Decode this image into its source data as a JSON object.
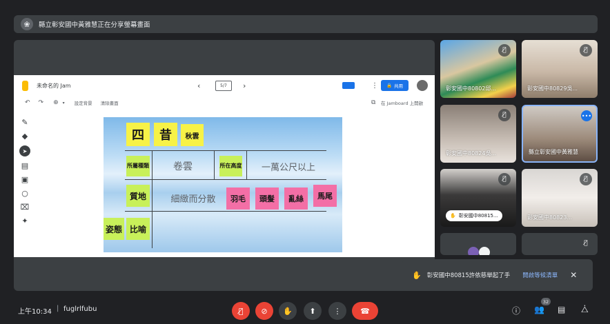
{
  "presenting_bar": {
    "text": "縣立彰安國中黃雅慧正在分享螢幕畫面"
  },
  "jamboard": {
    "title": "未命名的 Jam",
    "frame": "5/7",
    "share_label": "共用",
    "toolbar": {
      "set_bg": "設定背景",
      "clear_frame": "清除畫面",
      "present_label": "在 Jamboard 上開啟"
    }
  },
  "board": {
    "notes": {
      "si": "四",
      "xi": "昔",
      "qiuyun": "秋雲",
      "suoshu": "所屬種類",
      "juanyun": "卷雲",
      "suozai": "所在高度",
      "gaodu": "一萬公尺以上",
      "zhidi": "質地",
      "xizhi": "細緻而分散",
      "yumao": "羽毛",
      "toufa": "頭髮",
      "luansi": "亂絲",
      "mawei": "馬尾",
      "zitai": "姿態",
      "biyu": "比喻"
    }
  },
  "participants": [
    {
      "name": "彰安國中80802邱...",
      "muted": true
    },
    {
      "name": "彰安國中80829吳...",
      "muted": true
    },
    {
      "name": "彰安國中80824吳...",
      "muted": true
    },
    {
      "name": "縣立彰安國中黃雅慧",
      "muted": false
    },
    {
      "name": "彰安國中80815...",
      "muted": true
    },
    {
      "name": "彰安國中80823...",
      "muted": true
    },
    {
      "name": "",
      "muted": false
    },
    {
      "name": "",
      "muted": true
    }
  ],
  "toast": {
    "text": "彰安國中80815許依慈舉起了手",
    "action": "開啟等候清單"
  },
  "bottom": {
    "time": "上午10:34",
    "meeting_code": "fuglrlfubu",
    "people_count": "32"
  },
  "colors": {
    "end_call": "#ea4335",
    "accent": "#8ab4f8"
  }
}
